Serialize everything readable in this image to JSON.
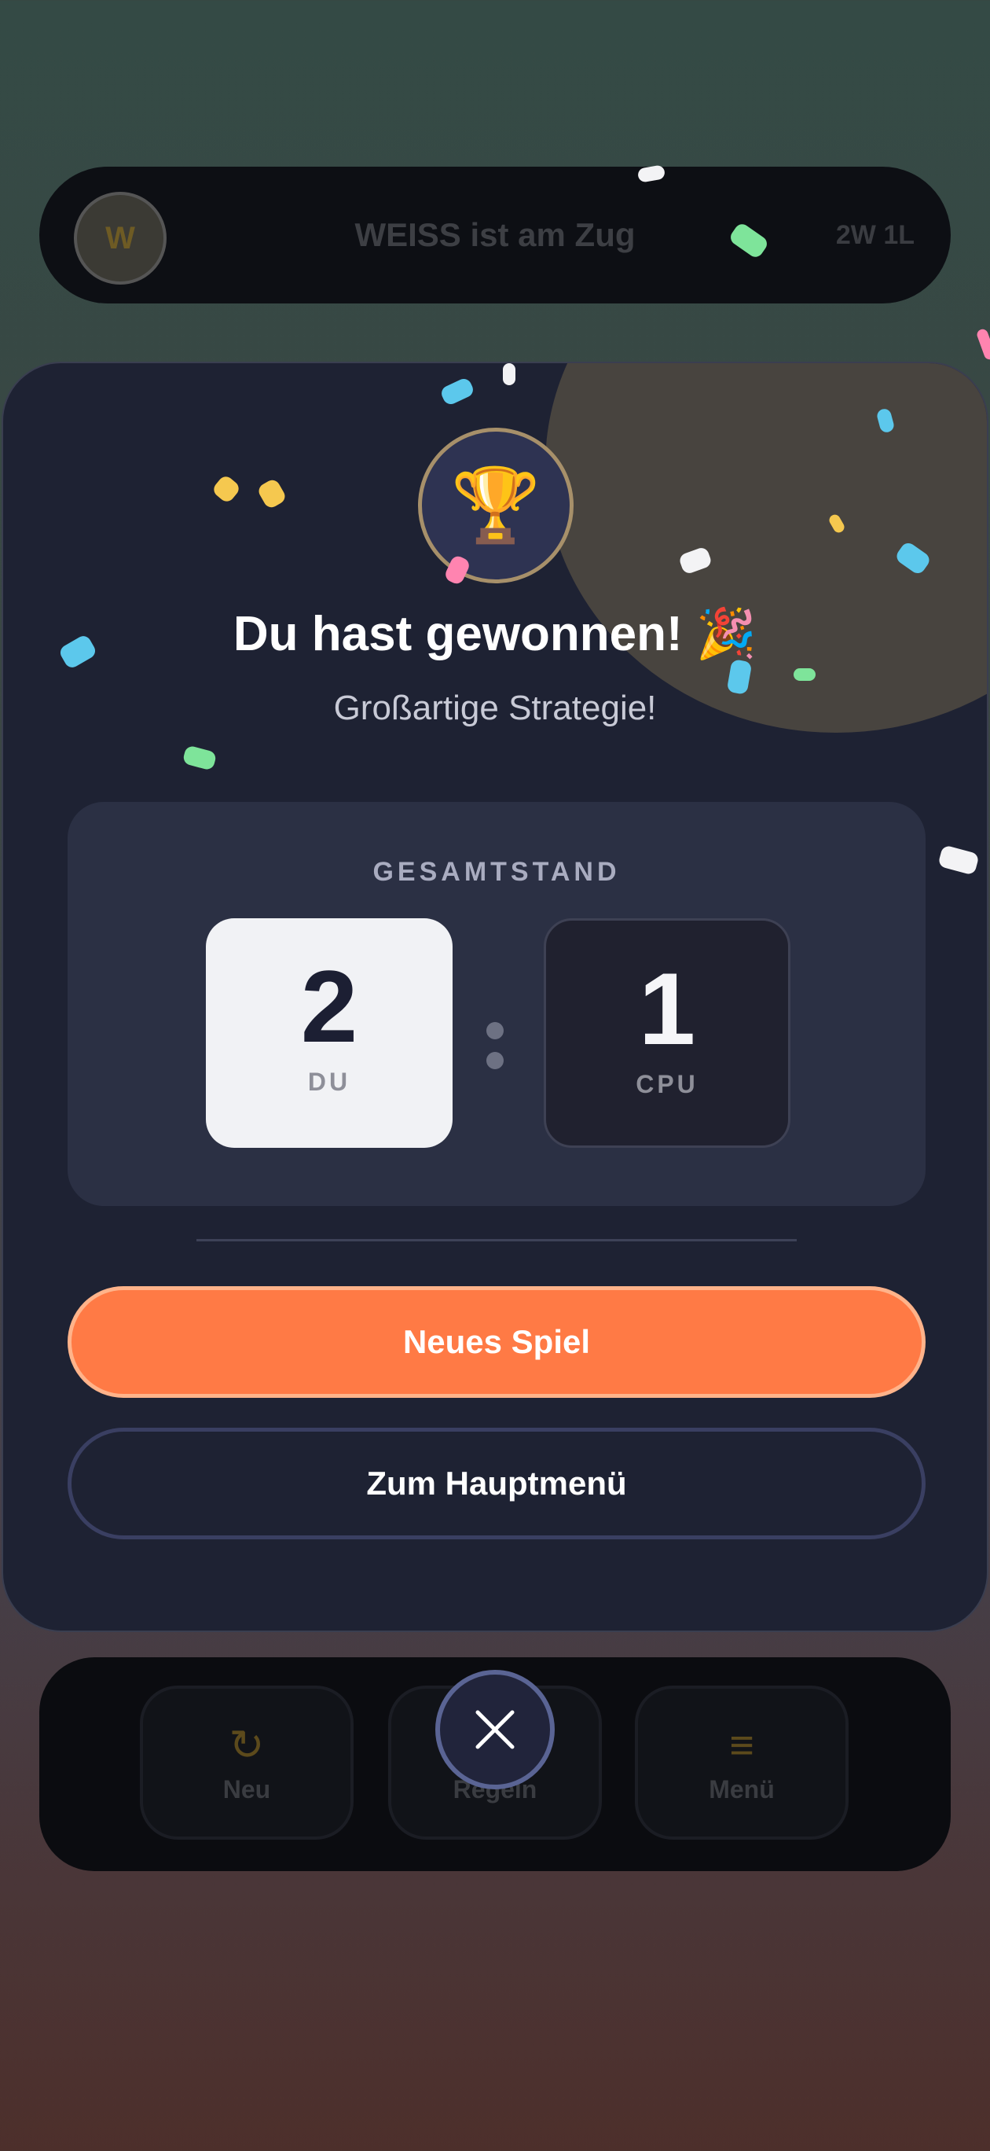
{
  "topbar": {
    "avatar_letter": "W",
    "turn_text": "WEISS ist am Zug",
    "record": "2W 1L"
  },
  "controls": [
    {
      "label": "Neu",
      "icon": "refresh-icon"
    },
    {
      "label": "Regeln",
      "icon": "book-icon"
    },
    {
      "label": "Menü",
      "icon": "menu-icon"
    }
  ],
  "modal": {
    "trophy_icon": "🏆",
    "title": "Du hast gewonnen! 🎉",
    "subtitle": "Großartige Strategie!",
    "score_heading": "GESAMTSTAND",
    "player_score": "2",
    "player_label": "DU",
    "cpu_score": "1",
    "cpu_label": "CPU",
    "primary_button": "Neues Spiel",
    "secondary_button": "Zum Hauptmenü"
  },
  "colors": {
    "accent": "#ff7a45",
    "modal_bg": "#1e2233",
    "panel_bg": "#2b3044"
  }
}
